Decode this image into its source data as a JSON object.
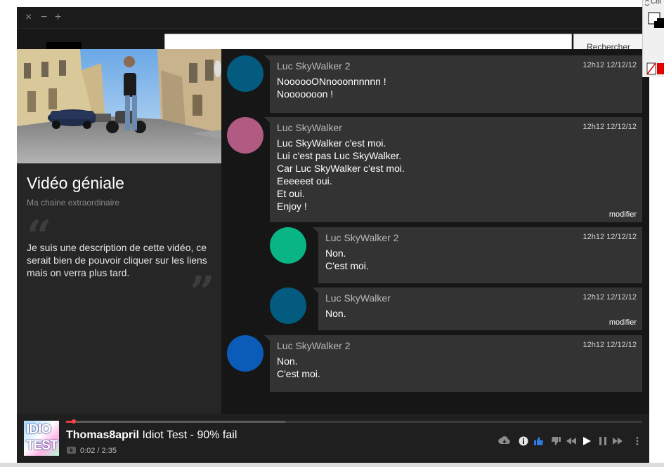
{
  "window": {
    "close_glyph": "×",
    "minimize_glyph": "−",
    "maximize_glyph": "+"
  },
  "search": {
    "placeholder": "",
    "button_label": "Rechercher"
  },
  "video": {
    "title": "Vidéo géniale",
    "channel": "Ma chaine extraordinaire",
    "description": "Je suis une description de cette vidéo, ce serait bien de pouvoir cliquer sur les liens mais on verra plus tard.",
    "quote_open": "“",
    "quote_close": "”"
  },
  "comments": [
    {
      "author": "Luc SkyWalker 2",
      "time": "12h12 12/12/12",
      "avatar_color": "#035b80",
      "lines": [
        "NoooooONnooonnnnnn !",
        "Nooooooon !"
      ],
      "edit_label": ""
    },
    {
      "author": "Luc SkyWalker",
      "time": "12h12 12/12/12",
      "avatar_color": "#b15a82",
      "lines": [
        "Luc SkyWalker c'est moi.",
        "Lui c'est pas Luc SkyWalker.",
        "Car Luc SkyWalker c'est moi.",
        "Eeeeeet oui.",
        "Et oui.",
        "Enjoy !"
      ],
      "edit_label": "modifier"
    },
    {
      "author": "Luc SkyWalker 2",
      "time": "12h12 12/12/12",
      "avatar_color": "#09b585",
      "lines": [
        "Non.",
        "C'est moi."
      ],
      "edit_label": ""
    },
    {
      "author": "Luc SkyWalker",
      "time": "12h12 12/12/12",
      "avatar_color": "#035b80",
      "lines": [
        "Non."
      ],
      "edit_label": "modifier"
    },
    {
      "author": "Luc SkyWalker 2",
      "time": "12h12 12/12/12",
      "avatar_color": "#0a5cb8",
      "lines": [
        "Non.",
        "C'est moi."
      ],
      "edit_label": ""
    }
  ],
  "player": {
    "thumb_line1": "IDIO",
    "thumb_line2": "TEST",
    "user": "Thomas8april",
    "track": "Idiot Test - 90% fail",
    "time": "0:02 / 2:35",
    "progress_percent": 1.3,
    "buffer_percent": 38,
    "like_color": "#2f7be0",
    "controls": [
      "cloud-download-icon",
      "info-icon",
      "thumbs-up-icon",
      "thumbs-down-icon",
      "rewind-icon",
      "play-icon",
      "pause-icon",
      "fast-forward-icon",
      "more-icon"
    ]
  },
  "color_panel": {
    "label": "Col"
  }
}
